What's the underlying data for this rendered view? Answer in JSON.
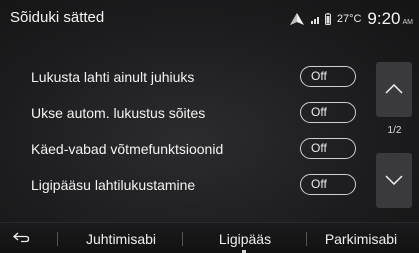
{
  "header": {
    "title": "Sõiduki sätted",
    "temperature": "27°C",
    "time": "9:20",
    "ampm": "AM"
  },
  "settings": [
    {
      "label": "Lukusta lahti ainult juhiuks",
      "value": "Off"
    },
    {
      "label": "Ukse autom. lukustus sõites",
      "value": "Off"
    },
    {
      "label": "Käed-vabad võtmefunktsioonid",
      "value": "Off"
    },
    {
      "label": "Ligipääsu lahtilukustamine",
      "value": "Off"
    }
  ],
  "pager": {
    "indicator": "1/2"
  },
  "tabs": {
    "items": [
      "Juhtimisabi",
      "Ligipääs",
      "Parkimisabi"
    ],
    "active": "Ligipääs"
  },
  "icons": {
    "status": [
      "navigation-arrow-icon",
      "signal-bars-icon",
      "phone-battery-icon"
    ],
    "back": "back-arrow-icon",
    "pager_up": "chevron-up-icon",
    "pager_down": "chevron-down-icon"
  }
}
